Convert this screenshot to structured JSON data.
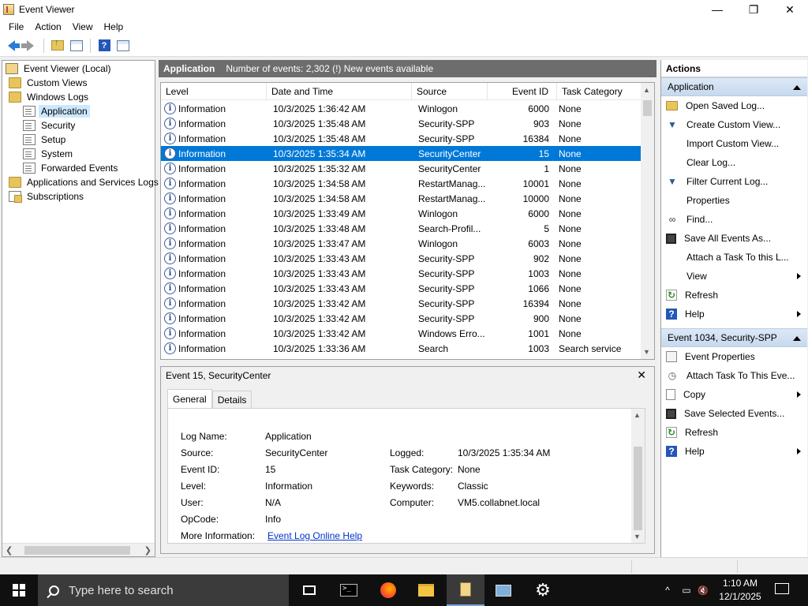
{
  "window": {
    "title": "Event Viewer",
    "minimize_glyph": "—",
    "restore_glyph": "❐",
    "close_glyph": "✕"
  },
  "menu": [
    "File",
    "Action",
    "View",
    "Help"
  ],
  "toolbar": {
    "icons": [
      "back-arrow-icon",
      "forward-arrow-icon",
      "folder-up-icon",
      "show-hide-tree-icon",
      "help-icon",
      "show-hide-action-pane-icon"
    ]
  },
  "tree": {
    "root": "Event Viewer (Local)",
    "custom_views": "Custom Views",
    "windows_logs": "Windows Logs",
    "logs": [
      "Application",
      "Security",
      "Setup",
      "System",
      "Forwarded Events"
    ],
    "apps_services": "Applications and Services Logs",
    "subscriptions": "Subscriptions",
    "selected": "Application"
  },
  "center": {
    "log_name": "Application",
    "summary": "Number of events: 2,302 (!) New events available"
  },
  "grid": {
    "columns": [
      "Level",
      "Date and Time",
      "Source",
      "Event ID",
      "Task Category"
    ],
    "rows": [
      {
        "level": "Information",
        "date": "10/3/2025 1:36:42 AM",
        "source": "Winlogon",
        "id": "6000",
        "cat": "None"
      },
      {
        "level": "Information",
        "date": "10/3/2025 1:35:48 AM",
        "source": "Security-SPP",
        "id": "903",
        "cat": "None"
      },
      {
        "level": "Information",
        "date": "10/3/2025 1:35:48 AM",
        "source": "Security-SPP",
        "id": "16384",
        "cat": "None"
      },
      {
        "level": "Information",
        "date": "10/3/2025 1:35:34 AM",
        "source": "SecurityCenter",
        "id": "15",
        "cat": "None"
      },
      {
        "level": "Information",
        "date": "10/3/2025 1:35:32 AM",
        "source": "SecurityCenter",
        "id": "1",
        "cat": "None"
      },
      {
        "level": "Information",
        "date": "10/3/2025 1:34:58 AM",
        "source": "RestartManag...",
        "id": "10001",
        "cat": "None"
      },
      {
        "level": "Information",
        "date": "10/3/2025 1:34:58 AM",
        "source": "RestartManag...",
        "id": "10000",
        "cat": "None"
      },
      {
        "level": "Information",
        "date": "10/3/2025 1:33:49 AM",
        "source": "Winlogon",
        "id": "6000",
        "cat": "None"
      },
      {
        "level": "Information",
        "date": "10/3/2025 1:33:48 AM",
        "source": "Search-Profil...",
        "id": "5",
        "cat": "None"
      },
      {
        "level": "Information",
        "date": "10/3/2025 1:33:47 AM",
        "source": "Winlogon",
        "id": "6003",
        "cat": "None"
      },
      {
        "level": "Information",
        "date": "10/3/2025 1:33:43 AM",
        "source": "Security-SPP",
        "id": "902",
        "cat": "None"
      },
      {
        "level": "Information",
        "date": "10/3/2025 1:33:43 AM",
        "source": "Security-SPP",
        "id": "1003",
        "cat": "None"
      },
      {
        "level": "Information",
        "date": "10/3/2025 1:33:43 AM",
        "source": "Security-SPP",
        "id": "1066",
        "cat": "None"
      },
      {
        "level": "Information",
        "date": "10/3/2025 1:33:42 AM",
        "source": "Security-SPP",
        "id": "16394",
        "cat": "None"
      },
      {
        "level": "Information",
        "date": "10/3/2025 1:33:42 AM",
        "source": "Security-SPP",
        "id": "900",
        "cat": "None"
      },
      {
        "level": "Information",
        "date": "10/3/2025 1:33:42 AM",
        "source": "Windows Erro...",
        "id": "1001",
        "cat": "None"
      },
      {
        "level": "Information",
        "date": "10/3/2025 1:33:36 AM",
        "source": "Search",
        "id": "1003",
        "cat": "Search service"
      }
    ],
    "selected_index": 3
  },
  "detail": {
    "title": "Event 15, SecurityCenter",
    "close_glyph": "✕",
    "tabs": [
      "General",
      "Details"
    ],
    "active_tab": "General",
    "labels": {
      "log_name": "Log Name:",
      "source": "Source:",
      "event_id": "Event ID:",
      "level": "Level:",
      "user": "User:",
      "opcode": "OpCode:",
      "more_info": "More Information:",
      "logged": "Logged:",
      "task_category": "Task Category:",
      "keywords": "Keywords:",
      "computer": "Computer:"
    },
    "values": {
      "log_name": "Application",
      "source": "SecurityCenter",
      "event_id": "15",
      "level": "Information",
      "user": "N/A",
      "opcode": "Info",
      "more_info_link": "Event Log Online Help",
      "logged": "10/3/2025 1:35:34 AM",
      "task_category": "None",
      "keywords": "Classic",
      "computer": "VM5.collabnet.local"
    }
  },
  "actions": {
    "title": "Actions",
    "section1": "Application",
    "section1_items": [
      "Open Saved Log...",
      "Create Custom View...",
      "Import Custom View...",
      "Clear Log...",
      "Filter Current Log...",
      "Properties",
      "Find...",
      "Save All Events As...",
      "Attach a Task To this L...",
      "View",
      "Refresh",
      "Help"
    ],
    "section2": "Event 1034, Security-SPP",
    "section2_items": [
      "Event Properties",
      "Attach Task To This Eve...",
      "Copy",
      "Save Selected Events...",
      "Refresh",
      "Help"
    ]
  },
  "taskbar": {
    "search_placeholder": "Type here to search",
    "time": "1:10 AM",
    "date": "12/1/2025",
    "terminal_glyph": ">_",
    "gear_glyph": "⚙",
    "tray_chevron": "^",
    "tray_network": "▭",
    "tray_volume": "🔇"
  }
}
